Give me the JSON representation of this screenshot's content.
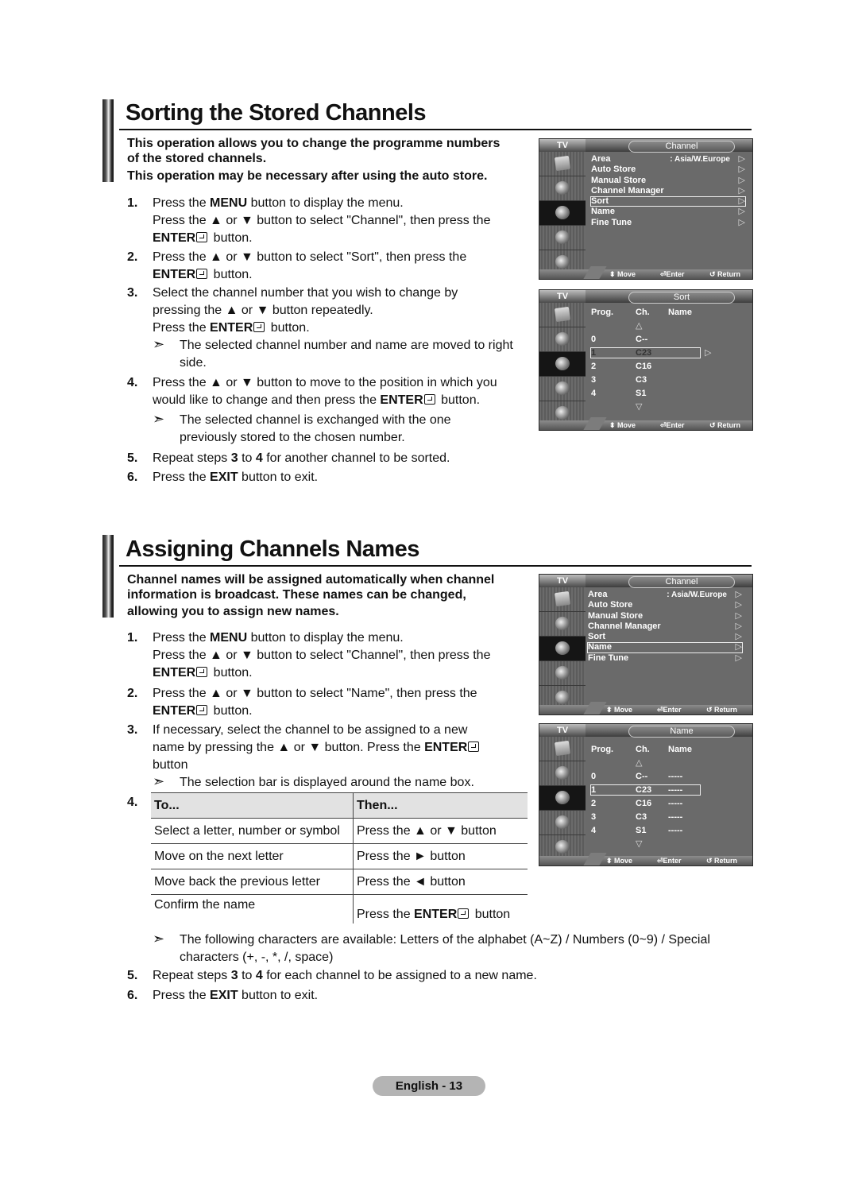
{
  "sorting": {
    "title": "Sorting the Stored Channels",
    "intro_1": "This operation allows you to change the programme numbers",
    "intro_2": "of the stored channels.",
    "intro_3": "This operation may be necessary after using the auto store.",
    "steps": [
      {
        "num": "1.",
        "l1_pre": "Press the ",
        "l1_bold": "MENU",
        "l1_post": " button to display the menu.",
        "l2": "Press the ▲ or ▼ button to select \"Channel\", then press the",
        "l3_bold": "ENTER",
        "l3_post": " button."
      },
      {
        "num": "2.",
        "l1": "Press the ▲ or ▼ button to select \"Sort\", then press the",
        "l2_bold": "ENTER",
        "l2_post": " button."
      },
      {
        "num": "3.",
        "l1": "Select the channel number that you wish to change by",
        "l2": "pressing the ▲ or ▼ button repeatedly.",
        "l3_pre": "Press the ",
        "l3_bold": "ENTER",
        "l3_post": " button.",
        "note_1": "The selected channel number and name are moved to right",
        "note_2": "side."
      },
      {
        "num": "4.",
        "l1": "Press the ▲ or ▼ button to move to the position in which you",
        "l2_pre": "would like to change and then press the ",
        "l2_bold": "ENTER",
        "l2_post": " button.",
        "note_1": "The selected channel is exchanged with the one",
        "note_2": "previously stored to the chosen number."
      },
      {
        "num": "5.",
        "pre": "Repeat steps ",
        "b1": "3",
        "mid": " to ",
        "b2": "4",
        "post": " for another channel to be sorted."
      },
      {
        "num": "6.",
        "pre": "Press the ",
        "bold": "EXIT",
        "post": " button to exit."
      }
    ]
  },
  "naming": {
    "title": "Assigning Channels Names",
    "intro_1": "Channel names will be assigned automatically when channel",
    "intro_2": "information is broadcast. These names can be changed,",
    "intro_3": "allowing you to assign new names.",
    "steps": [
      {
        "num": "1.",
        "l1_pre": "Press the ",
        "l1_bold": "MENU",
        "l1_post": " button to display the menu.",
        "l2": "Press the ▲ or ▼ button to select \"Channel\", then press the",
        "l3_bold": "ENTER",
        "l3_post": " button."
      },
      {
        "num": "2.",
        "l1": "Press the ▲ or ▼ button to select \"Name\", then press the",
        "l2_bold": "ENTER",
        "l2_post": " button."
      },
      {
        "num": "3.",
        "l1": "If necessary, select the channel to be assigned to a new",
        "l2_pre": "name by pressing the ▲ or ▼ button. Press the ",
        "l2_bold": "ENTER",
        "l3": "button",
        "note": "The selection bar is displayed around the name box."
      },
      {
        "num": "4."
      },
      {
        "num": "5.",
        "pre": "Repeat steps ",
        "b1": "3",
        "mid": " to ",
        "b2": "4",
        "post": " for each channel to be assigned to a new name."
      },
      {
        "num": "6.",
        "pre": "Press the ",
        "bold": "EXIT",
        "post": " button to exit."
      }
    ],
    "table": {
      "headers": [
        "To...",
        "Then..."
      ],
      "rows": [
        [
          "Select a letter, number or symbol",
          "Press the ▲ or ▼ button"
        ],
        [
          "Move on the next letter",
          "Press the ► button"
        ],
        [
          "Move back the previous letter",
          "Press the ◄ button"
        ],
        [
          "Confirm the name",
          "Press the ",
          "ENTER",
          " button"
        ]
      ]
    },
    "chars_note_1": "The following characters are available: Letters of the alphabet (A~Z) / Numbers (0~9) / Special",
    "chars_note_2": "characters (+, -, *, /, space)"
  },
  "osd": {
    "tv_label": "TV",
    "hints": {
      "move": "Move",
      "enter": "Enter",
      "return": "Return"
    },
    "channel_menu": {
      "title": "Channel",
      "items": [
        "Area",
        "Auto Store",
        "Manual Store",
        "Channel Manager",
        "Sort",
        "Name",
        "Fine Tune"
      ],
      "area_value": ": Asia/W.Europe"
    },
    "sort_screen": {
      "title": "Sort",
      "headers": [
        "Prog.",
        "Ch.",
        "Name"
      ],
      "rows": [
        [
          "0",
          "C--",
          ""
        ],
        [
          "1",
          "C23",
          ""
        ],
        [
          "2",
          "C16",
          ""
        ],
        [
          "3",
          "C3",
          ""
        ],
        [
          "4",
          "S1",
          ""
        ]
      ],
      "selected_index": 1
    },
    "name_screen": {
      "title": "Name",
      "headers": [
        "Prog.",
        "Ch.",
        "Name"
      ],
      "rows": [
        [
          "0",
          "C--",
          "-----"
        ],
        [
          "1",
          "C23",
          "-----"
        ],
        [
          "2",
          "C16",
          "-----"
        ],
        [
          "3",
          "C3",
          "-----"
        ],
        [
          "4",
          "S1",
          "-----"
        ]
      ],
      "selected_index": 1
    }
  },
  "footer": {
    "page_label": "English - 13"
  }
}
